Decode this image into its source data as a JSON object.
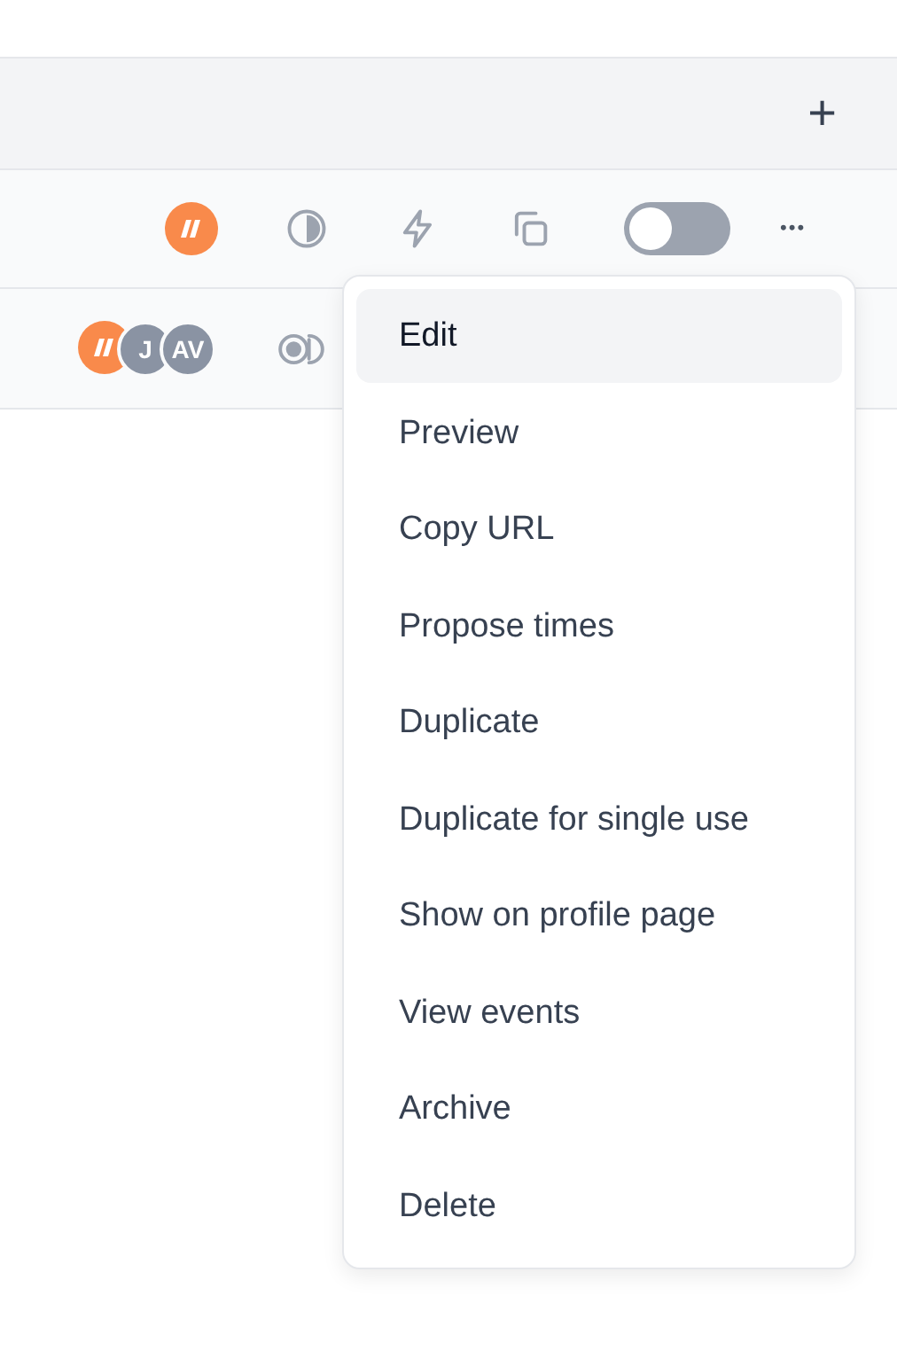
{
  "header": {
    "add_label": "+"
  },
  "rows": [
    {
      "avatars": [
        {
          "kind": "logo"
        }
      ],
      "toggle": {
        "on": false
      },
      "more": "•••"
    },
    {
      "avatars": [
        {
          "kind": "logo"
        },
        {
          "kind": "initials",
          "text": "J"
        },
        {
          "kind": "initials",
          "text": "AV"
        }
      ]
    }
  ],
  "menu": [
    {
      "label": "Edit",
      "selected": true
    },
    {
      "label": "Preview",
      "selected": false
    },
    {
      "label": "Copy URL",
      "selected": false
    },
    {
      "label": "Propose times",
      "selected": false
    },
    {
      "label": "Duplicate",
      "selected": false
    },
    {
      "label": "Duplicate for single use",
      "selected": false
    },
    {
      "label": "Show on profile page",
      "selected": false
    },
    {
      "label": "View events",
      "selected": false
    },
    {
      "label": "Archive",
      "selected": false
    },
    {
      "label": "Delete",
      "selected": false
    }
  ]
}
